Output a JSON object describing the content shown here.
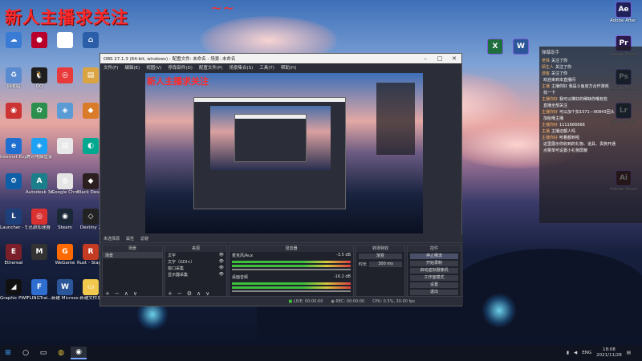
{
  "banner": {
    "text": "新人主播求关注",
    "squiggle": "~~"
  },
  "desktop_icons": [
    {
      "label": "",
      "color": "#3a7bd5",
      "glyph": "☁"
    },
    {
      "label": "",
      "color": "#b8002a",
      "glyph": "●"
    },
    {
      "label": "",
      "color": "#ffffff",
      "glyph": "▦"
    },
    {
      "label": "",
      "color": "#2a5ea8",
      "glyph": "⌂"
    },
    {
      "label": "回收站",
      "color": "#5a8ad0",
      "glyph": "♻"
    },
    {
      "label": "QQ",
      "color": "#1e1e1e",
      "glyph": "🐧"
    },
    {
      "label": "",
      "color": "#e83a3a",
      "glyph": "◎"
    },
    {
      "label": "",
      "color": "#d9a441",
      "glyph": "▤"
    },
    {
      "label": "",
      "color": "#cc3333",
      "glyph": "◉"
    },
    {
      "label": "",
      "color": "#2d8f4e",
      "glyph": "✿"
    },
    {
      "label": "",
      "color": "#5b9bd5",
      "glyph": "◈"
    },
    {
      "label": "",
      "color": "#d97b29",
      "glyph": "◆"
    },
    {
      "label": "Internet Explorer",
      "color": "#1f6fd0",
      "glyph": "e"
    },
    {
      "label": "腾讯电脑管家",
      "color": "#1da1f2",
      "glyph": "◈"
    },
    {
      "label": "",
      "color": "#e8e8e8",
      "glyph": "▤"
    },
    {
      "label": "",
      "color": "#00a88f",
      "glyph": "◐"
    },
    {
      "label": "",
      "color": "#0f5fa8",
      "glyph": "⚙"
    },
    {
      "label": "Autodesk 3ds Max",
      "color": "#1a7f8a",
      "glyph": "A"
    },
    {
      "label": "Google Chrome",
      "color": "#e5e5e5",
      "glyph": "◍"
    },
    {
      "label": "Black Desert",
      "color": "#2b1f1f",
      "glyph": "◆"
    },
    {
      "label": "Launcher - 快捷方式",
      "color": "#1d3f7a",
      "glyph": "L"
    },
    {
      "label": "迅游加速器",
      "color": "#d93030",
      "glyph": "◎"
    },
    {
      "label": "Steam",
      "color": "#1b2838",
      "glyph": "◉"
    },
    {
      "label": "Destiny 2",
      "color": "#222",
      "glyph": "◇"
    },
    {
      "label": "Ethereal",
      "color": "#7b1f2a",
      "glyph": "E"
    },
    {
      "label": "",
      "color": "#333",
      "glyph": "M"
    },
    {
      "label": "WeGame",
      "color": "#ff6a00",
      "glyph": "G"
    },
    {
      "label": "Rust - Staging",
      "color": "#c23b22",
      "glyph": "R"
    },
    {
      "label": "Graphic PWR Gaming",
      "color": "#111",
      "glyph": "◢"
    },
    {
      "label": "FLINGTrai...",
      "color": "#2e6ed1",
      "glyph": "F"
    },
    {
      "label": "新建 Microsoft Word 文档",
      "color": "#2b579a",
      "glyph": "W"
    },
    {
      "label": "新建文件夹",
      "color": "#f2c94c",
      "glyph": "▭"
    }
  ],
  "right_icons": [
    {
      "label": "Adobe After Effects 2020",
      "color": "#1f1f5a",
      "glyph": "Ae"
    },
    {
      "label": "Adobe Premiere",
      "color": "#2a1a4a",
      "glyph": "Pr"
    },
    {
      "label": "Adobe Photoshop",
      "color": "#001e36",
      "glyph": "Ps"
    },
    {
      "label": "Adobe Lightroom",
      "color": "#001e36",
      "glyph": "Lr"
    },
    {
      "label": "Adobe Illustrator",
      "color": "#330000",
      "glyph": "Ai"
    },
    {
      "label": "",
      "color": "#1e6e3e",
      "glyph": "X"
    },
    {
      "label": "",
      "color": "#2b579a",
      "glyph": "W"
    }
  ],
  "obs": {
    "title": "OBS 27.1.3 (64-bit, windows) - 配置文件: 未命名 - 场景: 未命名",
    "menu": [
      "文件(F)",
      "编辑(E)",
      "视图(V)",
      "停靠部件(D)",
      "配置文件(P)",
      "场景集合(S)",
      "工具(T)",
      "帮助(H)"
    ],
    "toolbar": [
      "未选择源",
      "属性",
      "滤镜"
    ],
    "docks": {
      "scenes": {
        "title": "场景",
        "items": [
          "场景"
        ]
      },
      "sources": {
        "title": "来源",
        "items": [
          "文字",
          "文字（GDI+）",
          "窗口采集",
          "显示器采集"
        ]
      },
      "mixer": {
        "title": "混音器",
        "tracks": [
          {
            "name": "麦克风/Aux",
            "db": "-3.5 dB"
          },
          {
            "name": "桌面音频",
            "db": "-16.2 dB"
          }
        ]
      },
      "transitions": {
        "title": "转场特效",
        "mode": "渐变",
        "duration_label": "时长",
        "duration": "300 ms"
      },
      "controls": {
        "title": "控件",
        "buttons": [
          "停止推流",
          "开始录制",
          "启动虚拟摄像机",
          "工作室模式",
          "设置",
          "退出"
        ]
      }
    },
    "status": {
      "live_label": "LIVE:",
      "live_time": "00:00:00",
      "rec_label": "REC:",
      "rec_time": "00:00:00",
      "cpu": "CPU: 0.5%, 30.00 fps"
    }
  },
  "chat": {
    "title": "弹幕助手",
    "lines": [
      {
        "user": "老铁",
        "text": "关注了你"
      },
      {
        "user": "陌生人",
        "text": "关注了你"
      },
      {
        "user": "游客",
        "text": "关注了你"
      },
      {
        "user": "",
        "text": "欢迎来到本直播间"
      },
      {
        "user": "主播",
        "text": "主播你好 我是斗鱼官方合作游戏"
      },
      {
        "user": "",
        "text": "找一下"
      },
      {
        "user": "主播你好",
        "text": "我可以推好的稀缺你哦有些"
      },
      {
        "user": "",
        "text": "直播全部关注"
      },
      {
        "user": "主播你好",
        "text": "可以加个扣1071—90843回头"
      },
      {
        "user": "",
        "text": "加给哦主播"
      },
      {
        "user": "主播你好",
        "text": "1111666666"
      },
      {
        "user": "主播",
        "text": "主播还都人吗"
      },
      {
        "user": "主播你好",
        "text": "听着都到啦"
      },
      {
        "user": "",
        "text": "这里展示你收到的礼物、道具、贵族开通"
      },
      {
        "user": "",
        "text": "点菜单可设置小礼物屏蔽"
      }
    ]
  },
  "taskbar": {
    "icons": [
      "windows-icon",
      "search-icon",
      "task-view-icon",
      "chrome-icon",
      "obs-icon"
    ],
    "tray": {
      "lang": "ENG",
      "time": "18:08",
      "date": "2021/11/28"
    }
  }
}
